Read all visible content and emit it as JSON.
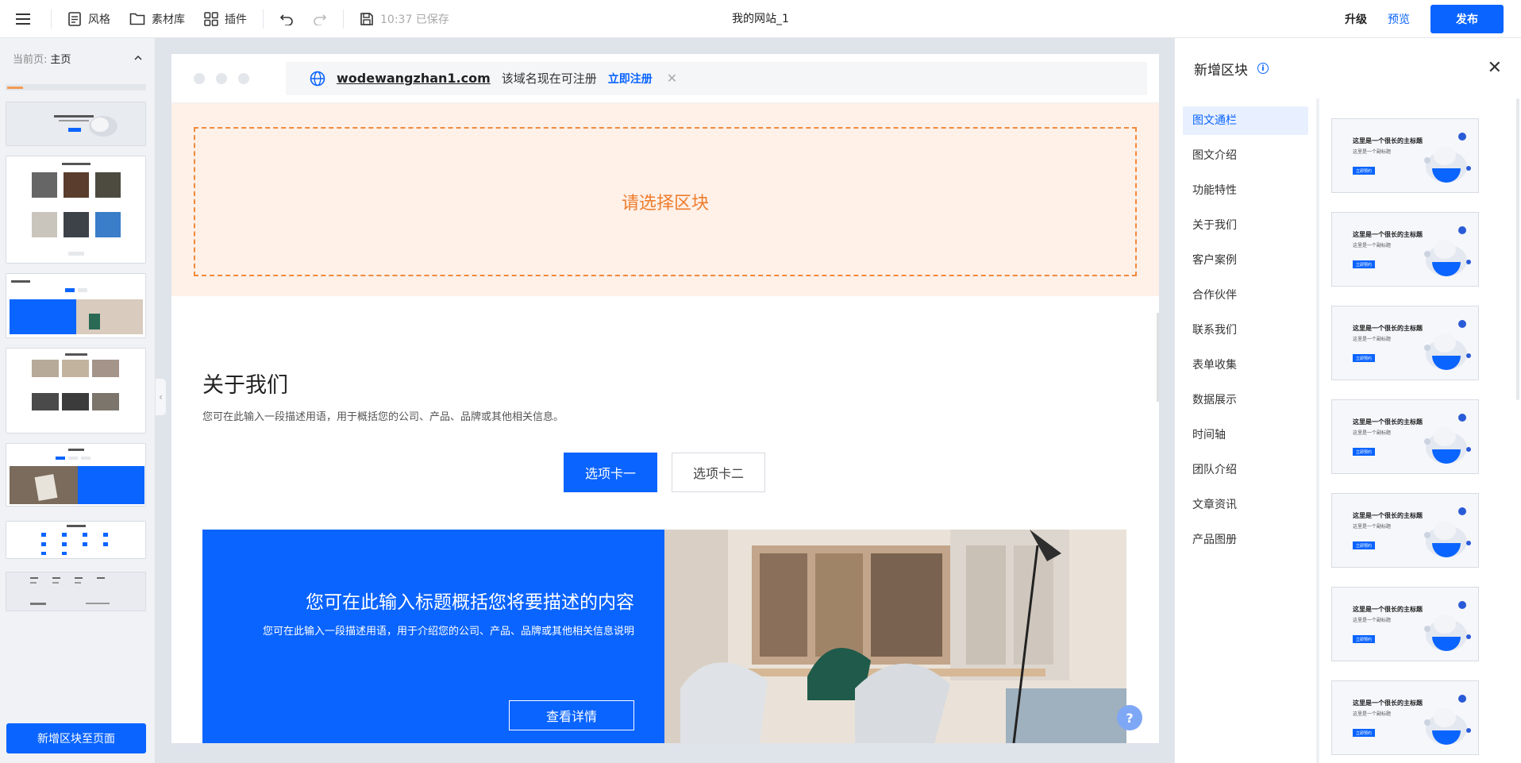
{
  "toolbar": {
    "style_label": "风格",
    "assets_label": "素材库",
    "plugins_label": "插件",
    "saved_status": "10:37 已保存",
    "site_title": "我的网站_1",
    "upgrade_label": "升级",
    "preview_label": "预览",
    "publish_label": "发布"
  },
  "leftbar": {
    "current_page_label": "当前页:",
    "current_page": "主页",
    "add_block_label": "新增区块至页面"
  },
  "canvas": {
    "domain": "wodewangzhan1.com",
    "domain_msg": "该域名现在可注册",
    "register_label": "立即注册",
    "select_block_label": "请选择区块",
    "about_title": "关于我们",
    "about_desc": "您可在此输入一段描述用语，用于概括您的公司、产品、品牌或其他相关信息。",
    "tabs": [
      "选项卡一",
      "选项卡二"
    ],
    "feature_title": "您可在此输入标题概括您将要描述的内容",
    "feature_desc": "您可在此输入一段描述用语，用于介绍您的公司、产品、品牌或其他相关信息说明",
    "feature_btn": "查看详情",
    "help_label": "?"
  },
  "rightpanel": {
    "title": "新增区块",
    "categories": [
      "图文通栏",
      "图文介绍",
      "功能特性",
      "关于我们",
      "客户案例",
      "合作伙伴",
      "联系我们",
      "表单收集",
      "数据展示",
      "时间轴",
      "团队介绍",
      "文章资讯",
      "产品图册"
    ],
    "template_title": "这里是一个很长的主标题",
    "template_subtitle": "这里是一个副标题",
    "template_btn": "立即预约"
  },
  "colors": {
    "accent": "#0a64ff",
    "warn": "#ef7d2c"
  }
}
